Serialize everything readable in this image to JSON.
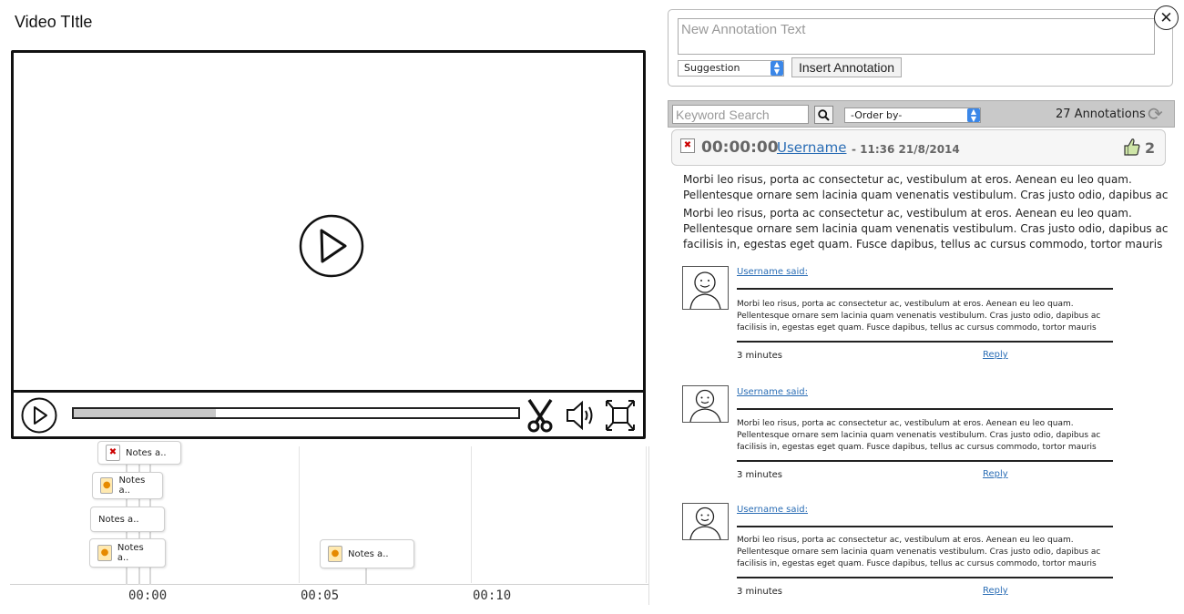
{
  "video": {
    "title": "Video TItle",
    "progress_fraction": 0.32
  },
  "timeline": {
    "labels": [
      "00:00",
      "00:05",
      "00:10"
    ],
    "notes": [
      "Notes a..",
      "Notes a..",
      "Notes a..",
      "Notes a..",
      "Notes a.."
    ]
  },
  "new_annotation": {
    "placeholder": "New Annotation Text",
    "type_value": "Suggestion",
    "insert_label": "Insert Annotation"
  },
  "filter": {
    "search_placeholder": "Keyword Search",
    "order_value": "-Order by-",
    "count_label": "27 Annotations"
  },
  "annotation": {
    "time": "00:00:00",
    "user": "Username",
    "meta": "- 11:36  21/8/2014",
    "likes": "2",
    "body": [
      "Morbi leo risus, porta ac consectetur ac, vestibulum at eros. Aenean eu leo quam.",
      "Pellentesque ornare sem lacinia quam venenatis vestibulum. Cras justo odio, dapibus ac",
      "Morbi leo risus, porta ac consectetur ac, vestibulum at eros. Aenean eu leo quam.",
      "Pellentesque ornare sem lacinia quam venenatis vestibulum. Cras justo odio, dapibus ac",
      "facilisis in, egestas eget quam. Fusce dapibus, tellus ac cursus commodo, tortor mauris"
    ]
  },
  "replies": [
    {
      "user": "Username said:",
      "lines": [
        "Morbi leo risus, porta ac consectetur ac, vestibulum at eros. Aenean eu leo quam.",
        "Pellentesque ornare sem lacinia quam venenatis vestibulum. Cras justo odio, dapibus ac",
        "facilisis in, egestas eget quam. Fusce dapibus, tellus ac cursus commodo, tortor mauris"
      ],
      "time": "3 minutes",
      "reply_label": "Reply"
    },
    {
      "user": "Username said:",
      "lines": [
        "Morbi leo risus, porta ac consectetur ac, vestibulum at eros. Aenean eu leo quam.",
        "Pellentesque ornare sem lacinia quam venenatis vestibulum. Cras justo odio, dapibus ac",
        "facilisis in, egestas eget quam. Fusce dapibus, tellus ac cursus commodo, tortor mauris"
      ],
      "time": "3 minutes",
      "reply_label": "Reply"
    },
    {
      "user": "Username said:",
      "lines": [
        "Morbi leo risus, porta ac consectetur ac, vestibulum at eros. Aenean eu leo quam.",
        "Pellentesque ornare sem lacinia quam venenatis vestibulum. Cras justo odio, dapibus ac",
        "facilisis in, egestas eget quam. Fusce dapibus, tellus ac cursus commodo, tortor mauris"
      ],
      "time": "3 minutes",
      "reply_label": "Reply"
    }
  ],
  "icons": {
    "play": "play-icon",
    "cut": "scissors-icon",
    "volume": "speaker-icon",
    "fullscreen": "fullscreen-icon",
    "close": "close-icon",
    "search": "search-icon",
    "refresh": "refresh-icon",
    "pin": "pin-icon",
    "lightbulb": "lightbulb-icon",
    "like": "thumbs-up-icon",
    "avatar": "avatar-icon"
  }
}
